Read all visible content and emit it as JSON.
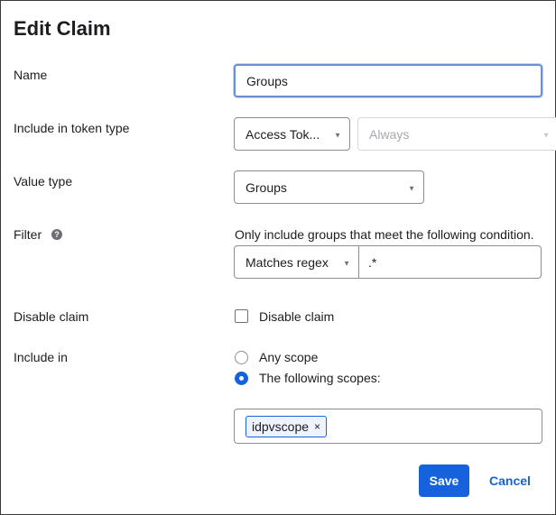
{
  "dialog": {
    "title": "Edit Claim"
  },
  "fields": {
    "name": {
      "label": "Name",
      "value": "Groups"
    },
    "token_type": {
      "label": "Include in token type",
      "selected": "Access Tok...",
      "secondary_selected": "Always"
    },
    "value_type": {
      "label": "Value type",
      "selected": "Groups"
    },
    "filter": {
      "label": "Filter",
      "help_icon": "question-mark-icon",
      "description": "Only include groups that meet the following condition.",
      "operator": "Matches regex",
      "value": ".*"
    },
    "disable_claim": {
      "label": "Disable claim",
      "checkbox_label": "Disable claim",
      "checked": false
    },
    "include_in": {
      "label": "Include in",
      "options": [
        "Any scope",
        "The following scopes:"
      ],
      "selected_index": 1,
      "scopes": [
        {
          "label": "idpvscope",
          "remove": "×"
        }
      ]
    }
  },
  "actions": {
    "save_label": "Save",
    "cancel_label": "Cancel"
  },
  "colors": {
    "accent": "#1662dd",
    "focus_border": "#6b8fd6"
  }
}
